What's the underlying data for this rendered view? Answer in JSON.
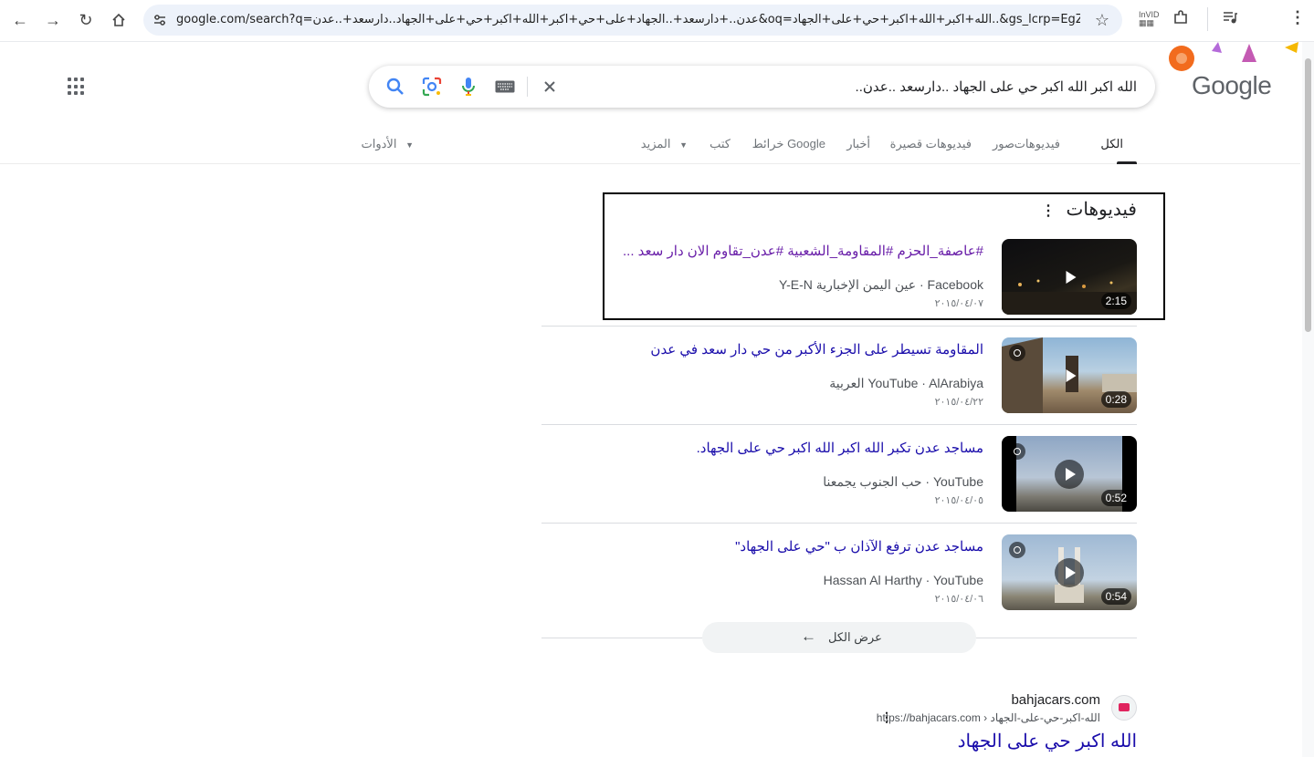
{
  "browser": {
    "url": "google.com/search?q=عدن..+دارسعد+..الجهاد+على+حي+اكبر+الله+اكبر+حي+على+الجهاد..دارسعد+..عدن&oq=الله+اكبر+الله+اكبر+حي+على+الجهاد..&gs_lcrp=EgZjaHJvbWUqB..."
  },
  "logo": {
    "text": "Google"
  },
  "search": {
    "query": "الله اكبر الله اكبر حي على الجهاد ..دارسعد ..عدن.."
  },
  "tabs": [
    {
      "label": "الكل"
    },
    {
      "label": "فيديوهات"
    },
    {
      "label": "صور"
    },
    {
      "label": "فيديوهات قصيرة"
    },
    {
      "label": "أخبار"
    },
    {
      "label": "خرائط Google"
    },
    {
      "label": "كتب"
    },
    {
      "label": "المزيد"
    },
    {
      "label": "الأدوات"
    }
  ],
  "videos": {
    "heading": "فيديوهات",
    "items": [
      {
        "title": "#عاصفة_الحزم #المقاومة_الشعبية #عدن_تقاوم الان دار سعد ...",
        "meta": "Facebook · عين اليمن الإخبارية Y-E-N",
        "date": "٢٠١٥/٠٤/٠٧",
        "duration": "2:15"
      },
      {
        "title": "المقاومة تسيطر على الجزء الأكبر من حي دار سعد في عدن",
        "meta": "YouTube · AlArabiya العربية",
        "date": "٢٠١٥/٠٤/٢٢",
        "duration": "0:28"
      },
      {
        "title": "مساجد عدن تكبر الله اكبر الله اكبر حي على الجهاد.",
        "meta": "YouTube · حب الجنوب يجمعنا",
        "date": "٢٠١٥/٠٤/٠٥",
        "duration": "0:52"
      },
      {
        "title": "مساجد عدن ترفع الآذان ب \"حي على الجهاد\"",
        "meta": "Hassan Al Harthy · YouTube",
        "date": "٢٠١٥/٠٤/٠٦",
        "duration": "0:54"
      }
    ],
    "view_all": "عرض الكل"
  },
  "result": {
    "site_name": "bahjacars.com",
    "url": "https://bahjacars.com › الله-اكبر-حي-على-الجهاد",
    "title": "الله اكبر حي على الجهاد"
  }
}
